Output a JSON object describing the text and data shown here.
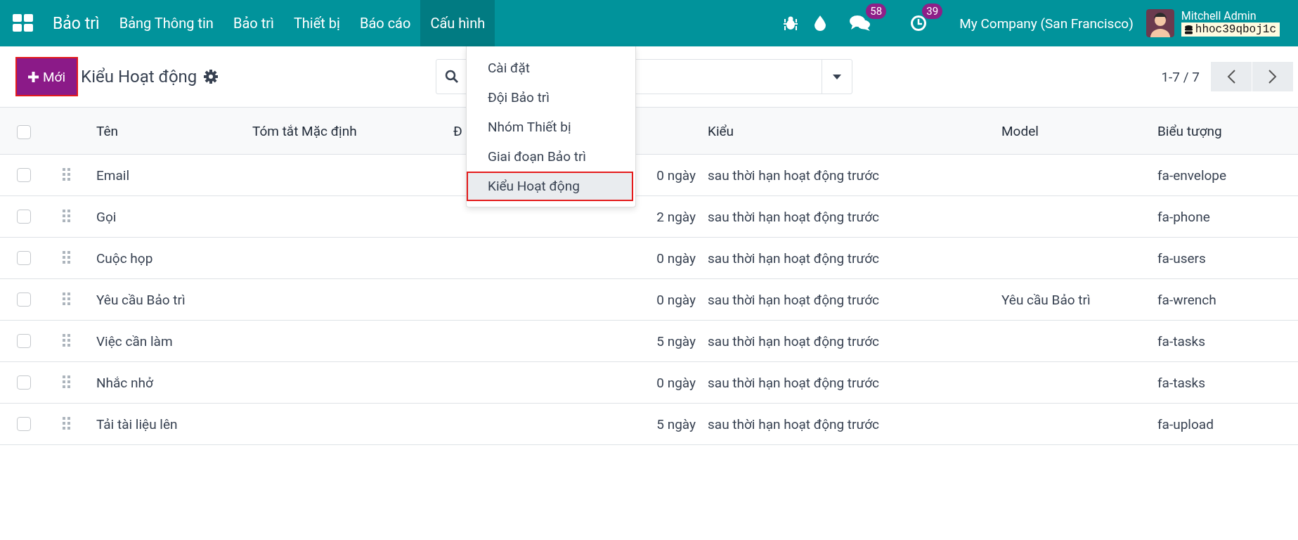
{
  "navbar": {
    "app_name": "Bảo trì",
    "menus": [
      {
        "label": "Bảng Thông tin",
        "selected": false
      },
      {
        "label": "Bảo trì",
        "selected": false
      },
      {
        "label": "Thiết bị",
        "selected": false
      },
      {
        "label": "Báo cáo",
        "selected": false
      },
      {
        "label": "Cấu hình",
        "selected": true
      }
    ],
    "messages_count": "58",
    "activities_count": "39",
    "company": "My Company (San Francisco)",
    "user": "Mitchell Admin",
    "database": "hhoc39qboj1c"
  },
  "config_menu": [
    {
      "label": "Cài đặt",
      "highlighted": false
    },
    {
      "label": "Đội Bảo trì",
      "highlighted": false
    },
    {
      "label": "Nhóm Thiết bị",
      "highlighted": false
    },
    {
      "label": "Giai đoạn Bảo trì",
      "highlighted": false
    },
    {
      "label": "Kiểu Hoạt động",
      "highlighted": true
    }
  ],
  "control_panel": {
    "new_button": {
      "label": "Mới",
      "highlighted": true
    },
    "title": "Kiểu Hoạt động",
    "pager": "1-7 / 7"
  },
  "table": {
    "all_checked": false,
    "columns": [
      "Tên",
      "Tóm tắt Mặc định",
      "Đ",
      "Kiểu",
      "Model",
      "Biểu tượng"
    ],
    "rows": [
      {
        "checked": false,
        "name": "Email",
        "delay": "0 ngày",
        "kind": "sau thời hạn hoạt động trước",
        "icon": "fa-envelope"
      },
      {
        "checked": false,
        "name": "Gọi",
        "delay": "2 ngày",
        "kind": "sau thời hạn hoạt động trước",
        "icon": "fa-phone"
      },
      {
        "checked": false,
        "name": "Cuộc họp",
        "delay": "0 ngày",
        "kind": "sau thời hạn hoạt động trước",
        "icon": "fa-users"
      },
      {
        "checked": false,
        "name": "Yêu cầu Bảo trì",
        "delay": "0 ngày",
        "kind": "sau thời hạn hoạt động trước",
        "model": "Yêu cầu Bảo trì",
        "icon": "fa-wrench"
      },
      {
        "checked": false,
        "name": "Việc cần làm",
        "delay": "5 ngày",
        "kind": "sau thời hạn hoạt động trước",
        "icon": "fa-tasks"
      },
      {
        "checked": false,
        "name": "Nhắc nhở",
        "delay": "0 ngày",
        "kind": "sau thời hạn hoạt động trước",
        "icon": "fa-tasks"
      },
      {
        "checked": false,
        "name": "Tải tài liệu lên",
        "delay": "5 ngày",
        "kind": "sau thời hạn hoạt động trước",
        "icon": "fa-upload"
      }
    ]
  }
}
